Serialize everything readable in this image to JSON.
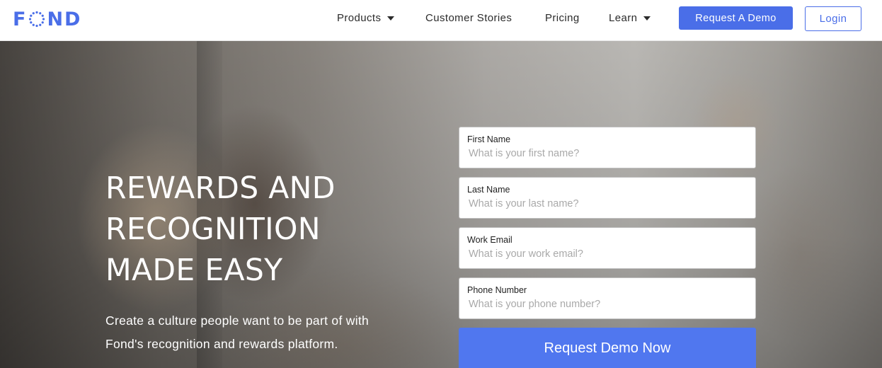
{
  "brand": {
    "logo_text_left": "F",
    "logo_text_right": "ND",
    "logo_color": "#4a6ee8",
    "logo_icon": "dotted-o-icon"
  },
  "nav": {
    "items": [
      {
        "label": "Products",
        "has_dropdown": true
      },
      {
        "label": "Customer Stories",
        "has_dropdown": false
      },
      {
        "label": "Pricing",
        "has_dropdown": false
      },
      {
        "label": "Learn",
        "has_dropdown": true
      }
    ],
    "request_demo_label": "Request A Demo",
    "login_label": "Login"
  },
  "hero": {
    "headline_lines": [
      "REWARDS AND",
      "RECOGNITION",
      "MADE EASY"
    ],
    "subtext_lines": [
      "Create a culture people want to be part of with",
      "Fond's recognition and rewards platform."
    ]
  },
  "form": {
    "fields": [
      {
        "label": "First Name",
        "placeholder": "What is your first name?",
        "value": ""
      },
      {
        "label": "Last Name",
        "placeholder": "What is your last name?",
        "value": ""
      },
      {
        "label": "Work Email",
        "placeholder": "What is your work email?",
        "value": ""
      },
      {
        "label": "Phone Number",
        "placeholder": "What is your phone number?",
        "value": ""
      }
    ],
    "submit_label": "Request Demo Now"
  },
  "colors": {
    "accent": "#4a6ee8",
    "submit": "#5077ef"
  }
}
